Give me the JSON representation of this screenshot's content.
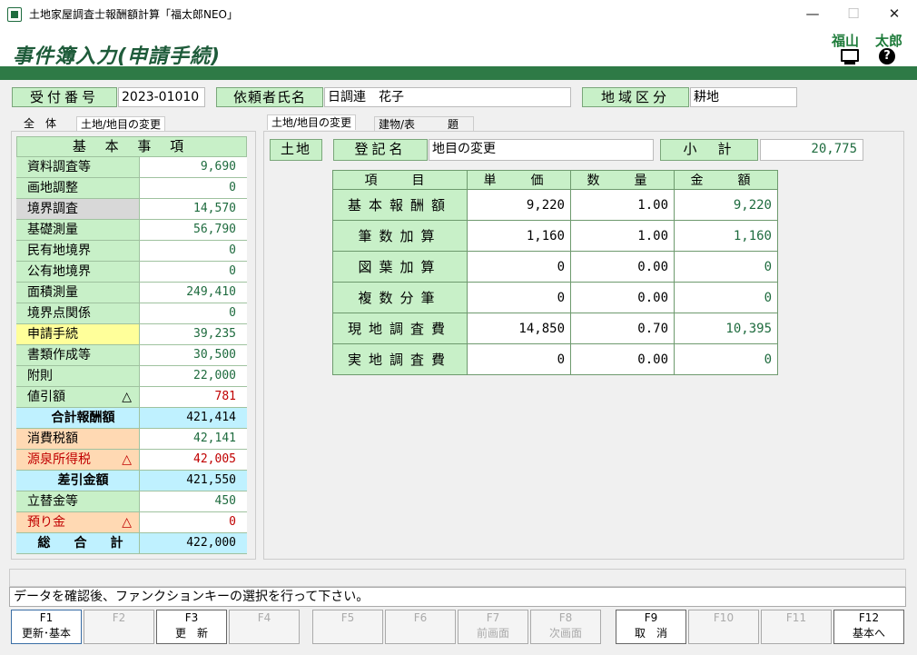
{
  "window": {
    "title": "土地家屋調査士報酬額計算「福太郎NEO」",
    "min": "—",
    "max": "☐",
    "close": "✕"
  },
  "header": {
    "title": "事件簿入力(申請手続)",
    "user1": "福山",
    "user2": "太郎"
  },
  "top": {
    "receipt_label": "受付番号",
    "receipt_value": "2023-01010",
    "client_label": "依頼者氏名",
    "client_value": "日調連　花子",
    "region_label": "地域区分",
    "region_value": "耕地"
  },
  "left_tabs": [
    "全　体",
    "土地/地目の変更"
  ],
  "left": {
    "header": "基 本 事 項",
    "rows": [
      {
        "k": "資料調査等",
        "v": "9,690"
      },
      {
        "k": "画地調整",
        "v": "0"
      },
      {
        "k": "境界調査",
        "v": "14,570"
      },
      {
        "k": "基礎測量",
        "v": "56,790"
      },
      {
        "k": "民有地境界",
        "v": "0"
      },
      {
        "k": "公有地境界",
        "v": "0"
      },
      {
        "k": "面積測量",
        "v": "249,410"
      },
      {
        "k": "境界点関係",
        "v": "0"
      },
      {
        "k": "申請手続",
        "v": "39,235"
      },
      {
        "k": "書類作成等",
        "v": "30,500"
      },
      {
        "k": "附則",
        "v": "22,000"
      },
      {
        "k": "値引額",
        "v": "781"
      },
      {
        "k": "合計報酬額",
        "v": "421,414"
      },
      {
        "k": "消費税額",
        "v": "42,141"
      },
      {
        "k": "源泉所得税",
        "v": "42,005"
      },
      {
        "k": "差引金額",
        "v": "421,550"
      },
      {
        "k": "立替金等",
        "v": "450"
      },
      {
        "k": "預り金",
        "v": "0"
      },
      {
        "k": "総　合　計",
        "v": "422,000"
      }
    ],
    "triangle": "△"
  },
  "right_tabs": [
    "土地/地目の変更",
    "建物/表　　　題"
  ],
  "right": {
    "land_label": "土地",
    "reg_label": "登記名",
    "reg_value": "地目の変更",
    "subtotal_label": "小　計",
    "subtotal_value": "20,775",
    "cols": [
      "項　目",
      "単　価",
      "数　量",
      "金　額"
    ],
    "rows": [
      {
        "name": "基本報酬額",
        "unit": "9,220",
        "qty": "1.00",
        "amount": "9,220"
      },
      {
        "name": "筆数加算",
        "unit": "1,160",
        "qty": "1.00",
        "amount": "1,160"
      },
      {
        "name": "図葉加算",
        "unit": "0",
        "qty": "0.00",
        "amount": "0"
      },
      {
        "name": "複数分筆",
        "unit": "0",
        "qty": "0.00",
        "amount": "0"
      },
      {
        "name": "現地調査費",
        "unit": "14,850",
        "qty": "0.70",
        "amount": "10,395"
      },
      {
        "name": "実地調査費",
        "unit": "0",
        "qty": "0.00",
        "amount": "0"
      }
    ]
  },
  "status": "データを確認後、ファンクションキーの選択を行って下さい。",
  "fkeys": [
    {
      "key": "F1",
      "label": "更新･基本"
    },
    {
      "key": "F2",
      "label": ""
    },
    {
      "key": "F3",
      "label": "更　新"
    },
    {
      "key": "F4",
      "label": ""
    },
    {
      "key": "F5",
      "label": ""
    },
    {
      "key": "F6",
      "label": ""
    },
    {
      "key": "F7",
      "label": "前画面"
    },
    {
      "key": "F8",
      "label": "次画面"
    },
    {
      "key": "F9",
      "label": "取　消"
    },
    {
      "key": "F10",
      "label": ""
    },
    {
      "key": "F11",
      "label": ""
    },
    {
      "key": "F12",
      "label": "基本へ"
    }
  ]
}
